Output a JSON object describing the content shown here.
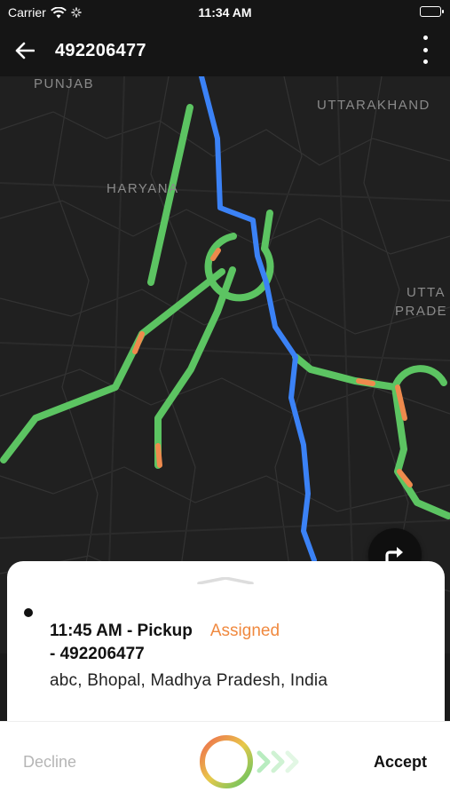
{
  "status_bar": {
    "carrier": "Carrier",
    "time": "11:34 AM"
  },
  "header": {
    "title": "492206477"
  },
  "map": {
    "labels": {
      "punjab": "PUNJAB",
      "uttarakhand": "UTTARAKHAND",
      "haryana": "HARYANA",
      "utta": "UTTA",
      "prade": "PRADE"
    },
    "route_colors": {
      "blue_route": "#3b82f6",
      "traffic_green": "#5cc462",
      "traffic_orange": "#ee8a4d"
    }
  },
  "pickup": {
    "time_label": "11:45 AM - Pickup",
    "status": "Assigned",
    "id_label": "- 492206477",
    "address": "abc, Bhopal, Madhya Pradesh, India"
  },
  "actions": {
    "decline": "Decline",
    "accept": "Accept"
  },
  "colors": {
    "status_assigned": "#f0893f",
    "decline_text": "#b5b5b5"
  }
}
